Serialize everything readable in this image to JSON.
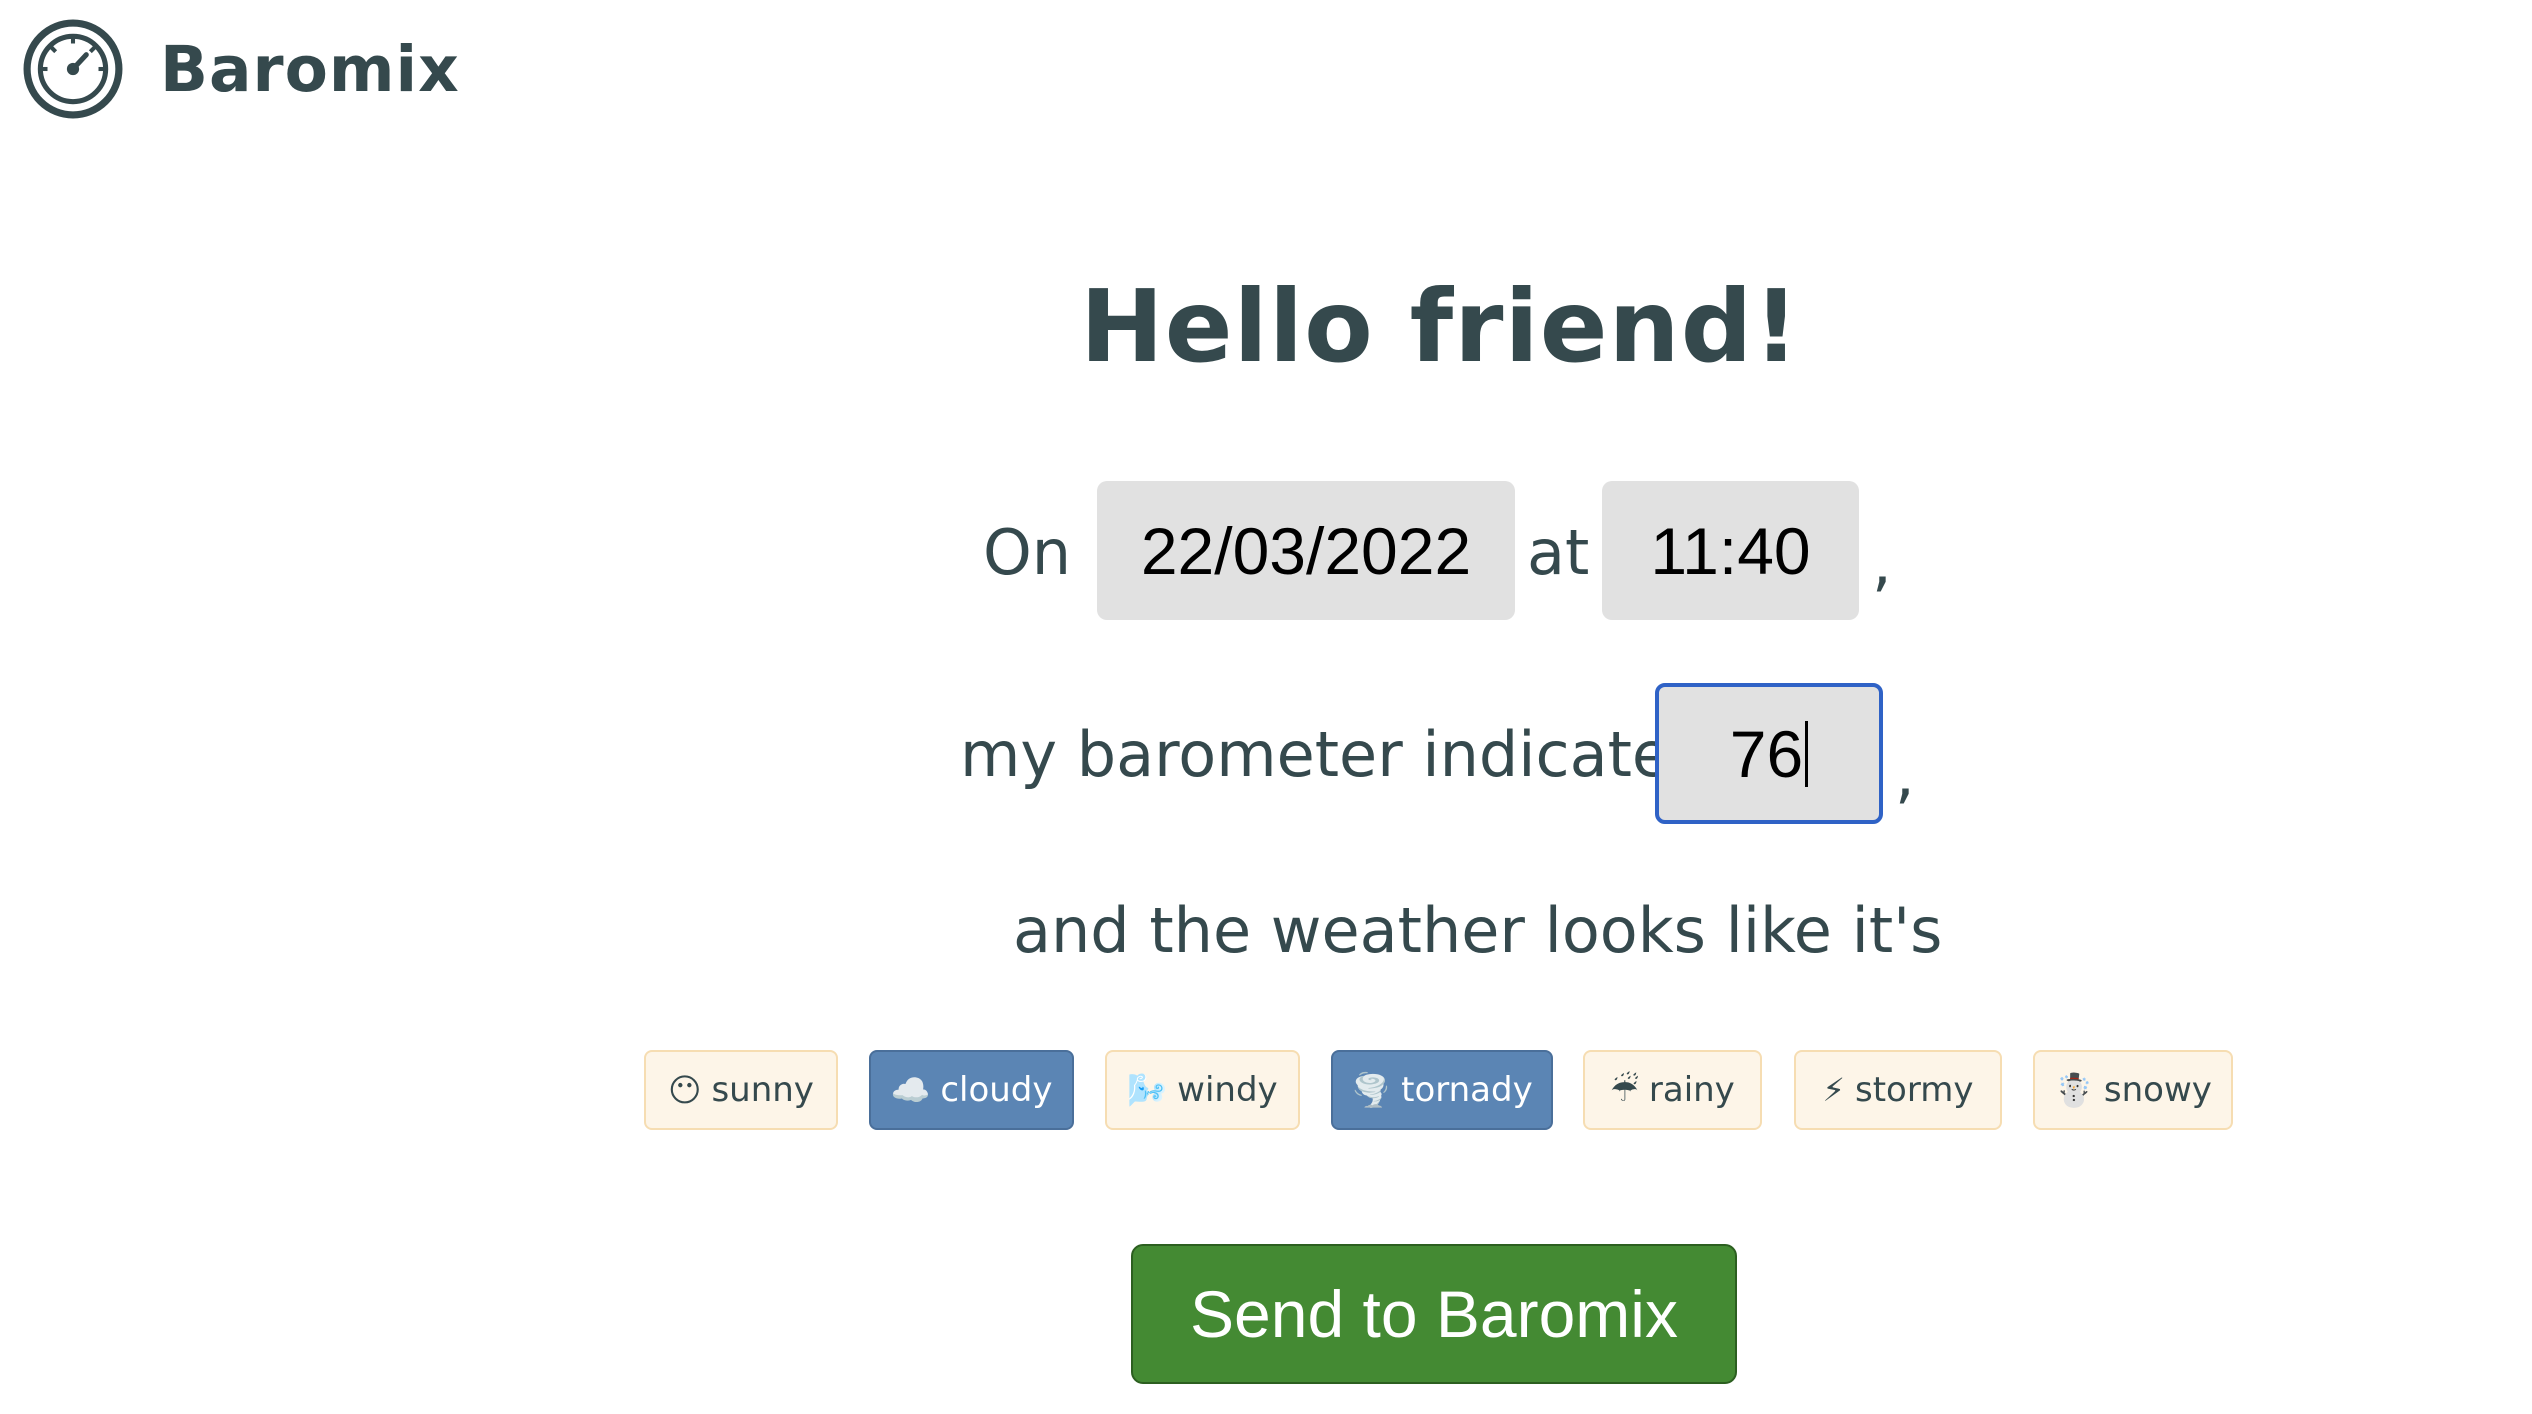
{
  "brand": {
    "name": "Baromix",
    "icon": "barometer-gauge-icon"
  },
  "main": {
    "title": "Hello friend!",
    "sentence": {
      "on": "On",
      "at": "at",
      "comma": ",",
      "barometer_prefix": "my barometer indicates",
      "weather_prefix": "and the weather looks like it's"
    },
    "date_value": "22/03/2022",
    "time_value": "11:40",
    "pressure_value": "76"
  },
  "weather_options": [
    {
      "label": "sunny",
      "emoji": "😶",
      "selected": false
    },
    {
      "label": "cloudy",
      "emoji": "☁️",
      "selected": true
    },
    {
      "label": "windy",
      "emoji": "🌬️",
      "selected": false
    },
    {
      "label": "tornady",
      "emoji": "🌪️",
      "selected": true
    },
    {
      "label": "rainy",
      "emoji": "☔",
      "selected": false
    },
    {
      "label": "stormy",
      "emoji": "⚡",
      "selected": false
    },
    {
      "label": "snowy",
      "emoji": "☃️",
      "selected": false
    }
  ],
  "actions": {
    "send_label": "Send to Baromix"
  },
  "colors": {
    "text": "#35494d",
    "input_bg": "#e1e1e1",
    "focus_border": "#2f62c6",
    "tag_bg": "#fdf5e8",
    "tag_border": "#f6ddb2",
    "tag_selected_bg": "#5b85b4",
    "send_bg": "#448a33"
  }
}
